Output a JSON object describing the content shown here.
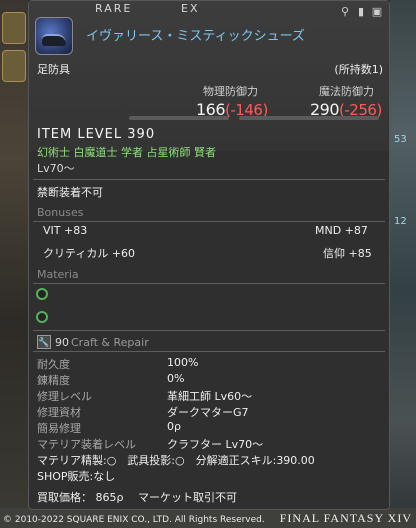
{
  "item": {
    "rarity": "RARE",
    "ex": "EX",
    "name": "イヴァリース・ミスティックシューズ",
    "category": "足防具",
    "owned": "(所持数1)",
    "phys_def_label": "物理防御力",
    "mag_def_label": "魔法防御力",
    "phys_def": "166",
    "phys_def_diff": "(-146)",
    "mag_def": "290",
    "mag_def_diff": "(-256)",
    "item_level": "ITEM LEVEL 390",
    "classes": "幻術士 白魔道士 学者 占星術師 賢者",
    "level": "Lv70～",
    "restriction": "禁断装着不可"
  },
  "bonuses": {
    "title": "Bonuses",
    "rows": [
      {
        "left": "VIT +83",
        "right": "MND +87"
      },
      {
        "left": "クリティカル +60",
        "right": "信仰 +85"
      }
    ]
  },
  "materia": {
    "title": "Materia"
  },
  "craft": {
    "badge": "🔧",
    "num": "90",
    "title": "Craft & Repair",
    "rows": [
      {
        "label": "耐久度",
        "value": "100%"
      },
      {
        "label": "錬精度",
        "value": "0%"
      },
      {
        "label": "修理レベル",
        "value": "革細工師 Lv60～"
      },
      {
        "label": "修理資材",
        "value": "ダークマターG7"
      },
      {
        "label": "簡易修理",
        "value": "0ρ"
      },
      {
        "label": "マテリア装着レベル",
        "value": "クラフター Lv70～"
      }
    ],
    "line1": "マテリア精製:○　武具投影:○　分解適正スキル:390.00",
    "line2": "SHOP販売:なし",
    "line3": "買取価格： 865ρ　 マーケット取引不可"
  },
  "footer": {
    "copyright": "© 2010-2022 SQUARE ENIX CO., LTD. All Rights Reserved.",
    "logo": "FINAL FANTASY XIV"
  },
  "background": {
    "right_text_1": "53",
    "right_text_2": "12"
  }
}
